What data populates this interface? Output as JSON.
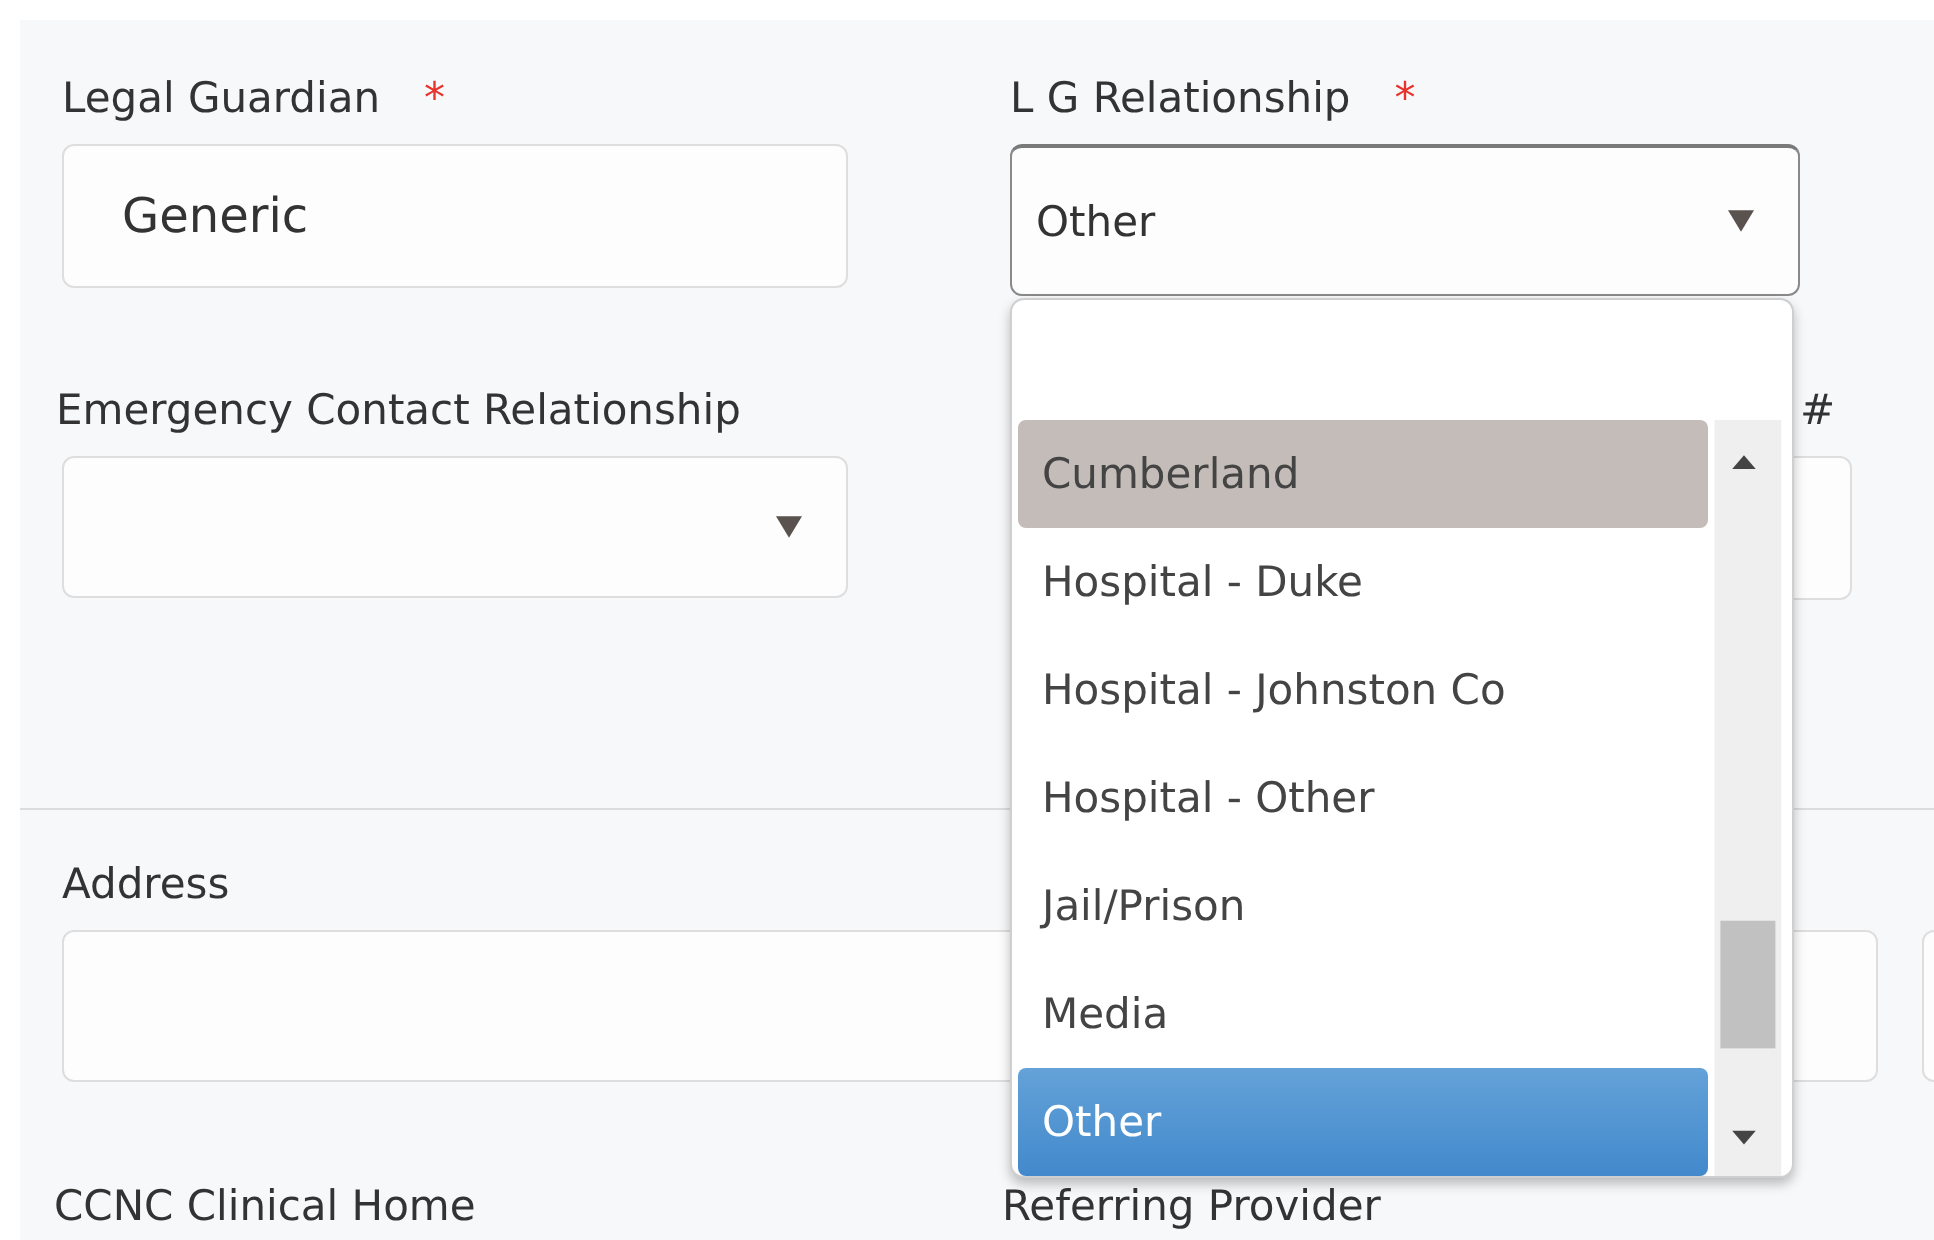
{
  "rows": [
    {
      "kind": "pair",
      "section_break": false,
      "fields": [
        {
          "kind": "text",
          "label": "Legal Guardian",
          "required_mark": "*",
          "value": "Generic"
        },
        {
          "kind": "select",
          "label": "L G Relationship",
          "required_mark": "*",
          "value": "Other",
          "focused": true
        }
      ]
    },
    {
      "kind": "trio",
      "section_break": false,
      "fields": [
        {
          "kind": "select",
          "label": "Emergency Contact Relationship",
          "focused": false
        },
        {
          "kind": "text",
          "label": "#"
        }
      ]
    },
    {
      "kind": "wide",
      "section_break": true,
      "fields": [
        {
          "kind": "text",
          "label": "Address"
        },
        {
          "kind": "text"
        }
      ]
    },
    {
      "kind": "labels",
      "section_break": false,
      "fields": [
        {
          "kind": "label",
          "label": "CCNC Clinical Home"
        },
        {
          "kind": "label",
          "label": "Referring Provider"
        }
      ]
    }
  ],
  "dropdown": {
    "options": [
      {
        "label": "Cumberland",
        "selected": false,
        "highlighted": true
      },
      {
        "label": "Hospital - Duke",
        "selected": false,
        "highlighted": false
      },
      {
        "label": "Hospital - Johnston Co",
        "selected": false,
        "highlighted": false
      },
      {
        "label": "Hospital - Other",
        "selected": false,
        "highlighted": false
      },
      {
        "label": "Jail/Prison",
        "selected": false,
        "highlighted": false
      },
      {
        "label": "Media",
        "selected": false,
        "highlighted": false
      },
      {
        "label": "Other",
        "selected": true,
        "highlighted": false
      }
    ]
  }
}
